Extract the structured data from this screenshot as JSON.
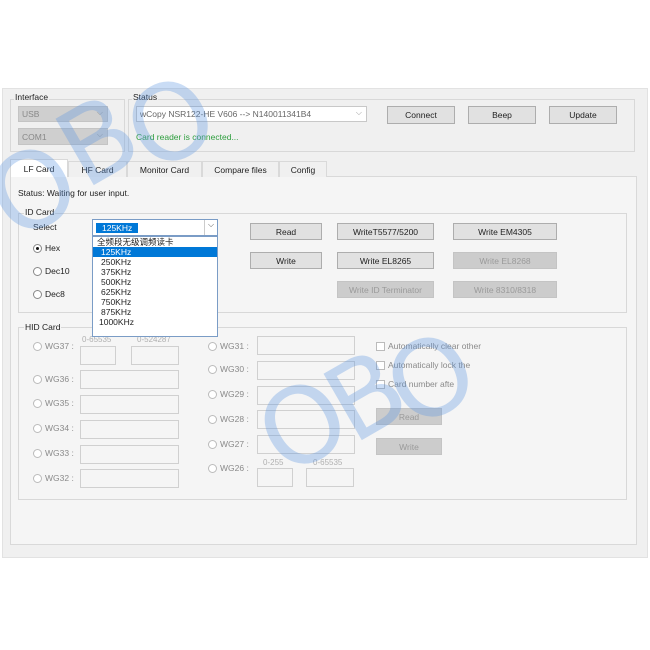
{
  "interface": {
    "label": "Interface",
    "port_type": "USB",
    "port": "COM1"
  },
  "status": {
    "label": "Status",
    "device": "wCopy NSR122-HE V606 --> N140011341B4",
    "message": "Card reader is connected...",
    "message_color": "#2e9e3e"
  },
  "top_buttons": {
    "connect": "Connect",
    "beep": "Beep",
    "update": "Update"
  },
  "tabs": [
    {
      "label": "LF Card",
      "active": true
    },
    {
      "label": "HF Card"
    },
    {
      "label": "Monitor Card"
    },
    {
      "label": "Compare files"
    },
    {
      "label": "Config"
    }
  ],
  "panel_status": "Status: Waiting for user input.",
  "id_card": {
    "label": "ID Card",
    "select_label": "Select",
    "selected": "125KHz",
    "options": [
      "全频段无级调频读卡",
      "125KHz",
      "250KHz",
      "375KHz",
      "500KHz",
      "625KHz",
      "750KHz",
      "875KHz",
      "1000KHz"
    ],
    "formats": [
      {
        "label": "Hex",
        "checked": true
      },
      {
        "label": "Dec10"
      },
      {
        "label": "Dec8"
      }
    ],
    "buttons": {
      "read": "Read",
      "write_t5577": "WriteT5577/5200",
      "write_em4305": "Write EM4305",
      "write": "Write",
      "write_el8265": "Write EL8265",
      "write_el8268": "Write EL8268",
      "write_id_terminator": "Write ID Terminator",
      "write_8310": "Write 8310/8318"
    }
  },
  "hid_card": {
    "label": "HID Card",
    "wg37": "WG37 :",
    "wg37_hint1": "0-65535",
    "wg37_hint2": "0-524287",
    "left": [
      "WG36 :",
      "WG35 :",
      "WG34 :",
      "WG33 :",
      "WG32 :"
    ],
    "right": [
      "WG31 :",
      "WG30 :",
      "WG29 :",
      "WG28 :",
      "WG27 :"
    ],
    "wg26": "WG26 :",
    "wg26_hint1": "0-255",
    "wg26_hint2": "0-65535",
    "checkboxes": [
      "Automatically clear other",
      "Automatically lock the",
      "Card number afte"
    ],
    "read": "Read",
    "write": "Write"
  },
  "watermark": [
    "O",
    "B",
    "O"
  ],
  "accent": "#0078d7"
}
